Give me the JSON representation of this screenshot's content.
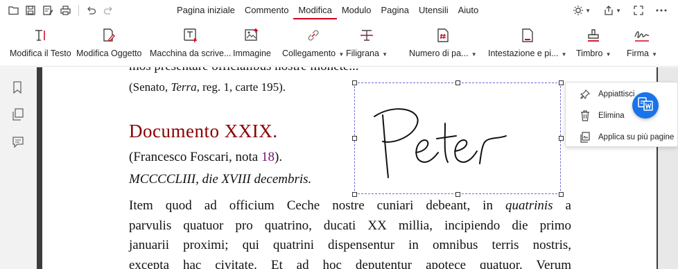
{
  "menubar": {
    "tabs": [
      {
        "label": "Pagina iniziale",
        "active": false
      },
      {
        "label": "Commento",
        "active": false
      },
      {
        "label": "Modifica",
        "active": true
      },
      {
        "label": "Modulo",
        "active": false
      },
      {
        "label": "Pagina",
        "active": false
      },
      {
        "label": "Utensili",
        "active": false
      },
      {
        "label": "Aiuto",
        "active": false
      }
    ],
    "quick_access_icons": [
      "folder-icon",
      "save-icon",
      "save-as-icon",
      "print-icon",
      "undo-icon",
      "redo-icon"
    ],
    "right_icons": [
      "theme-icon",
      "share-icon",
      "fullscreen-icon",
      "more-icon"
    ]
  },
  "ribbon": {
    "items": [
      {
        "label": "Modifica il Testo",
        "icon": "edit-text-icon",
        "dropdown": false
      },
      {
        "label": "Modifica Oggetto",
        "icon": "edit-object-icon",
        "dropdown": false
      },
      {
        "label": "Macchina da scrive...",
        "icon": "typewriter-icon",
        "dropdown": false
      },
      {
        "label": "Immagine",
        "icon": "image-icon",
        "dropdown": false
      },
      {
        "label": "Collegamento",
        "icon": "link-icon",
        "dropdown": true
      },
      {
        "label": "Filigrana",
        "icon": "watermark-icon",
        "dropdown": true
      },
      {
        "label": "Numero di pa...",
        "icon": "page-number-icon",
        "dropdown": true
      },
      {
        "label": "Intestazione e pi...",
        "icon": "header-footer-icon",
        "dropdown": true
      },
      {
        "label": "Timbro",
        "icon": "stamp-icon",
        "dropdown": true
      },
      {
        "label": "Firma",
        "icon": "signature-icon",
        "dropdown": true
      }
    ],
    "accent_color": "#d0021b"
  },
  "left_panel": {
    "icons": [
      "bookmark-icon",
      "pages-icon",
      "comment-icon"
    ]
  },
  "document": {
    "line_top": "mos presentare officialibus nostre monete...",
    "senato": {
      "pre": "(Senato, ",
      "italic": "Terra",
      "post": ", reg. 1, carte 195)."
    },
    "title": "Documento XXIX.",
    "foscari": {
      "pre": "(Francesco Foscari, nota ",
      "num": "18",
      "post": ")."
    },
    "date": "MCCCCLIII, die XVIII decembris.",
    "paragraph": [
      {
        "pre": "Item quod ad officium Ceche nostre cuniari debeant, in ",
        "italic": "quatrinis",
        "post": " a"
      },
      {
        "pre": "parvulis quatuor pro quatrino, ducati XX millia, incipiendo die primo",
        "italic": "",
        "post": ""
      },
      {
        "pre": "januarii proximi; qui quatrini dispensentur in omnibus terris nostris,",
        "italic": "",
        "post": ""
      },
      {
        "pre": "excepta hac civitate. Et ad hoc deputentur apotece quatuor. Verum",
        "italic": "",
        "post": ""
      }
    ],
    "title_color": "#8b0000"
  },
  "signature": {
    "text": "Peter"
  },
  "context_menu": {
    "items": [
      {
        "label": "Appiattisci",
        "icon": "pin-icon"
      },
      {
        "label": "Elimina",
        "icon": "trash-icon"
      },
      {
        "label": "Applica su più pagine",
        "icon": "multi-page-icon"
      }
    ]
  },
  "floating_button": {
    "icon": "convert-to-word-icon",
    "color": "#1a73e8"
  }
}
